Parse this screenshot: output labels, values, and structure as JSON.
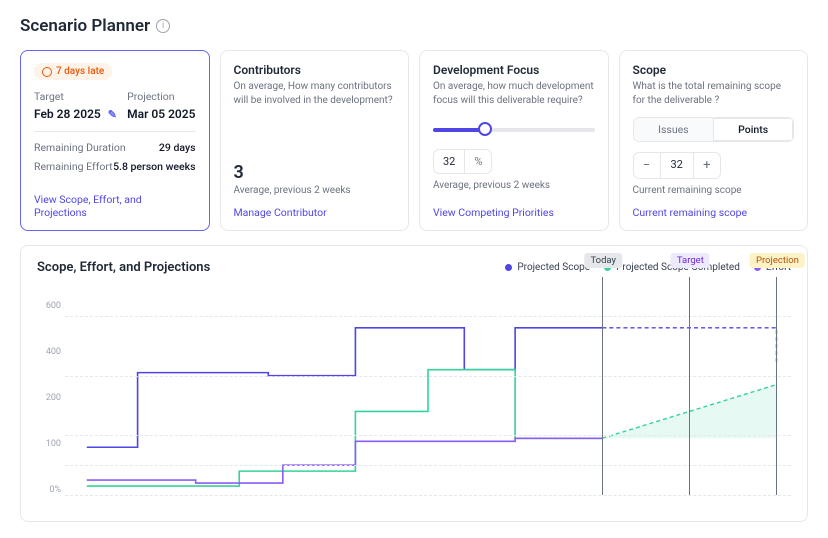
{
  "header": {
    "title": "Scenario Planner"
  },
  "summary": {
    "badge": "7 days late",
    "target_label": "Target",
    "target_value": "Feb 28 2025",
    "projection_label": "Projection",
    "projection_value": "Mar 05 2025",
    "remaining_duration_label": "Remaining Duration",
    "remaining_duration_value": "29 days",
    "remaining_effort_label": "Remaining Effort",
    "remaining_effort_value": "5.8 person weeks",
    "link": "View Scope, Effort, and Projections"
  },
  "contributors": {
    "title": "Contributors",
    "sub": "On average, How many contributors will be involved in the development?",
    "value": "3",
    "note": "Average, previous 2 weeks",
    "link": "Manage Contributor"
  },
  "focus": {
    "title": "Development Focus",
    "sub": "On average, how much development focus will this deliverable require?",
    "value": "32",
    "unit": "%",
    "note": "Average, previous 2 weeks",
    "link": "View Competing Priorities"
  },
  "scope": {
    "title": "Scope",
    "sub": "What is the total remaining scope for the deliverable ?",
    "tab_issues": "Issues",
    "tab_points": "Points",
    "value": "32",
    "note": "Current remaining scope",
    "link": "Current remaining scope"
  },
  "chart": {
    "title": "Scope, Effort, and Projections",
    "legend": {
      "projected_scope": "Projected Scope",
      "projected_completed": "Projected Scope Completed",
      "effort": "Effort"
    },
    "colors": {
      "projected_scope": "#4f46e5",
      "projected_completed": "#34d399",
      "effort": "#8b5cf6"
    },
    "markers": {
      "today": "Today",
      "target": "Target",
      "projection": "Projection"
    },
    "ylabels": [
      "600",
      "400",
      "200",
      "100",
      "0%"
    ]
  },
  "chart_data": {
    "type": "line",
    "ylim": [
      0,
      650
    ],
    "yticks": [
      0,
      100,
      200,
      400,
      600
    ],
    "x_range_pct": [
      0,
      100
    ],
    "markers_pct": {
      "today": 74,
      "target": 86,
      "projection": 98
    },
    "series": [
      {
        "name": "Projected Scope",
        "color": "#4f46e5",
        "points": [
          [
            3,
            160
          ],
          [
            10,
            160
          ],
          [
            10,
            410
          ],
          [
            28,
            410
          ],
          [
            28,
            400
          ],
          [
            40,
            400
          ],
          [
            40,
            560
          ],
          [
            55,
            560
          ],
          [
            55,
            420
          ],
          [
            62,
            420
          ],
          [
            62,
            560
          ],
          [
            74,
            560
          ]
        ],
        "projection": [
          [
            74,
            560
          ],
          [
            98,
            560
          ],
          [
            98,
            440
          ]
        ]
      },
      {
        "name": "Projected Scope Completed",
        "color": "#34d399",
        "points": [
          [
            3,
            30
          ],
          [
            24,
            30
          ],
          [
            24,
            80
          ],
          [
            40,
            80
          ],
          [
            40,
            280
          ],
          [
            50,
            280
          ],
          [
            50,
            420
          ],
          [
            62,
            420
          ],
          [
            62,
            190
          ],
          [
            74,
            190
          ]
        ],
        "projection": [
          [
            74,
            190
          ],
          [
            98,
            370
          ]
        ],
        "fill_to_y": 190
      },
      {
        "name": "Effort",
        "color": "#8b5cf6",
        "points": [
          [
            3,
            50
          ],
          [
            18,
            50
          ],
          [
            18,
            40
          ],
          [
            30,
            40
          ],
          [
            30,
            100
          ],
          [
            40,
            100
          ],
          [
            40,
            180
          ],
          [
            62,
            180
          ],
          [
            62,
            190
          ],
          [
            74,
            190
          ]
        ]
      }
    ]
  }
}
